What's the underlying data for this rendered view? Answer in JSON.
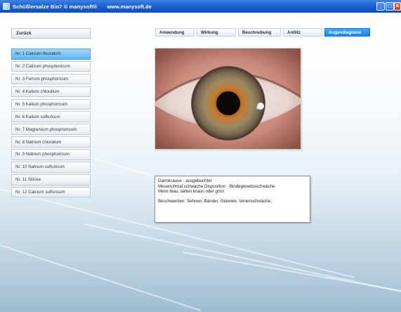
{
  "window": {
    "title": "Schüßlersalze Bio7 © manysoft®",
    "url": "www.manysoft.de",
    "controls": [
      "minimize",
      "maximize",
      "close"
    ]
  },
  "back_button": {
    "label": "Zurück"
  },
  "remedies": [
    {
      "label": "Nr. 1 Calcium fluoratum",
      "selected": true
    },
    {
      "label": "Nr. 2 Calcium phosphoricum"
    },
    {
      "label": "Nr. 3 Ferrum phosphoricum"
    },
    {
      "label": "Nr. 4 Kalium chloratum"
    },
    {
      "label": "Nr. 5 Kalium phosphoricum"
    },
    {
      "label": "Nr. 6 Kalium sulfuricum"
    },
    {
      "label": "Nr. 7 Magnesium phosphoricum"
    },
    {
      "label": "Nr. 8 Natrium chloratum"
    },
    {
      "label": "Nr. 9 Natrium phosphoricum"
    },
    {
      "label": "Nr. 10 Natrium sulfuricum"
    },
    {
      "label": "Nr. 11 Silicea"
    },
    {
      "label": "Nr. 12 Calcium sulfuricum"
    }
  ],
  "tabs": [
    {
      "label": "Anwendung"
    },
    {
      "label": "Wirkung"
    },
    {
      "label": "Beschreibung"
    },
    {
      "label": "Antlitz"
    },
    {
      "label": "Augendiagnose",
      "active": true
    }
  ],
  "description": {
    "lines": [
      "Darmkrause · ausgebuchtet",
      "Mesenchmal schwache Disposition · Bindegewebsschwäche",
      "Meist blau, selten braun oder grün"
    ],
    "complaints": "Beschwerden: Sehnen, Bänder, Gelenke, Venenschwäche,"
  },
  "colors": {
    "titlebar": "#1f63d3",
    "active_tab": "#1985e6",
    "selected_item": "#5fb8f5",
    "iris_inner": "#c8782e",
    "iris_outer": "#7a6a52"
  },
  "icons": {
    "app": "app-icon",
    "photo": "eye-closeup-photo"
  }
}
